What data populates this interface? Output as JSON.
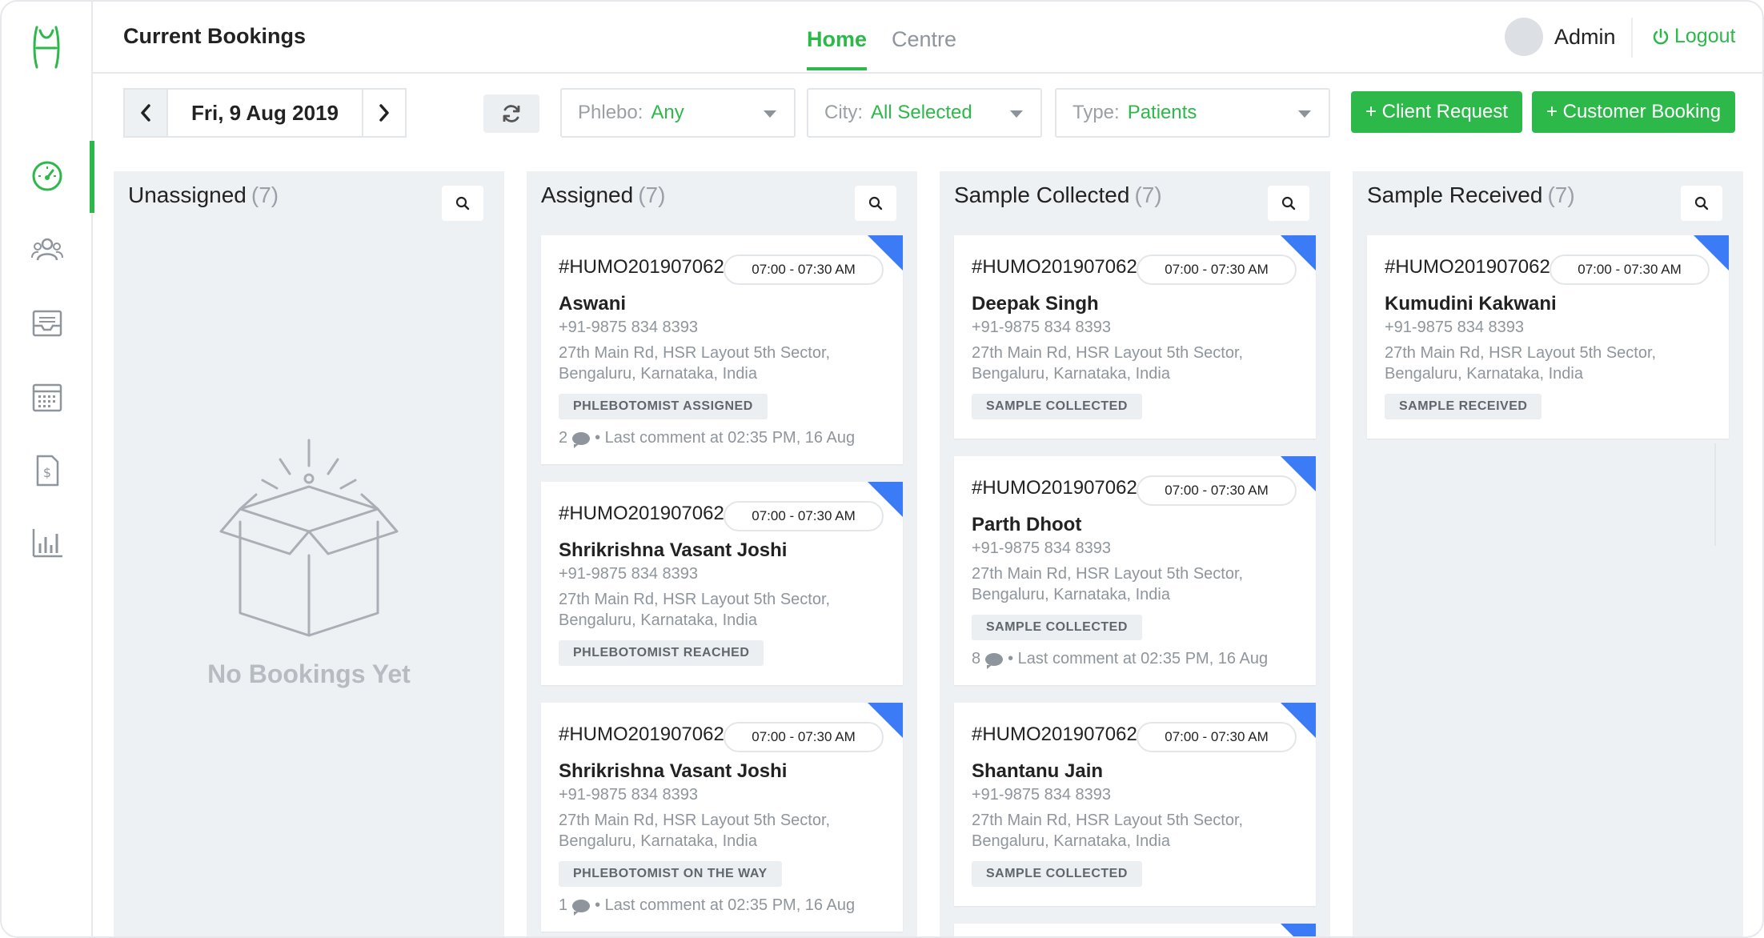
{
  "header": {
    "title": "Current Bookings",
    "tabs": [
      "Home",
      "Centre"
    ],
    "user": "Admin",
    "logout": "Logout"
  },
  "toolbar": {
    "date": "Fri, 9 Aug 2019",
    "phlebo": {
      "label": "Phlebo:",
      "value": "Any"
    },
    "city": {
      "label": "City:",
      "value": "All Selected"
    },
    "type": {
      "label": "Type:",
      "value": "Patients"
    },
    "client_request": "+ Client Request",
    "customer_booking": "+ Customer Booking"
  },
  "columns": [
    {
      "title": "Unassigned",
      "count": "(7)",
      "empty_text": "No Bookings Yet"
    },
    {
      "title": "Assigned",
      "count": "(7)"
    },
    {
      "title": "Sample Collected",
      "count": "(7)"
    },
    {
      "title": "Sample Received",
      "count": "(7)"
    }
  ],
  "cards": {
    "assigned": [
      {
        "id": "#HUMO2019070624",
        "slot": "07:00 - 07:30 AM",
        "name": "Aswani",
        "phone": "+91-9875 834 8393",
        "address_1": "27th Main Rd, HSR Layout 5th Sector,",
        "address_2": "Bengaluru, Karnataka, India",
        "status": "PHLEBOTOMIST ASSIGNED",
        "comment_count": "2",
        "comment_text": "• Last comment at 02:35 PM, 16 Aug"
      },
      {
        "id": "#HUMO2019070624",
        "slot": "07:00 - 07:30 AM",
        "name": "Shrikrishna Vasant Joshi",
        "phone": "+91-9875 834 8393",
        "address_1": "27th Main Rd, HSR Layout 5th Sector,",
        "address_2": "Bengaluru, Karnataka, India",
        "status": "PHLEBOTOMIST REACHED"
      },
      {
        "id": "#HUMO2019070624",
        "slot": "07:00 - 07:30 AM",
        "name": "Shrikrishna Vasant Joshi",
        "phone": "+91-9875 834 8393",
        "address_1": "27th Main Rd, HSR Layout 5th Sector,",
        "address_2": "Bengaluru, Karnataka, India",
        "status": "PHLEBOTOMIST ON THE WAY",
        "comment_count": "1",
        "comment_text": "• Last comment at 02:35 PM, 16 Aug"
      }
    ],
    "collected": [
      {
        "id": "#HUMO2019070624",
        "slot": "07:00 - 07:30 AM",
        "name": "Deepak Singh",
        "phone": "+91-9875 834 8393",
        "address_1": "27th Main Rd, HSR Layout 5th Sector,",
        "address_2": "Bengaluru, Karnataka, India",
        "status": "SAMPLE COLLECTED"
      },
      {
        "id": "#HUMO2019070624",
        "slot": "07:00 - 07:30 AM",
        "name": "Parth Dhoot",
        "phone": "+91-9875 834 8393",
        "address_1": "27th Main Rd, HSR Layout 5th Sector,",
        "address_2": "Bengaluru, Karnataka, India",
        "status": "SAMPLE COLLECTED",
        "comment_count": "8",
        "comment_text": "• Last comment at 02:35 PM, 16 Aug"
      },
      {
        "id": "#HUMO2019070624",
        "slot": "07:00 - 07:30 AM",
        "name": "Shantanu Jain",
        "phone": "+91-9875 834 8393",
        "address_1": "27th Main Rd, HSR Layout 5th Sector,",
        "address_2": "Bengaluru, Karnataka, India",
        "status": "SAMPLE COLLECTED"
      }
    ],
    "received": [
      {
        "id": "#HUMO2019070624",
        "slot": "07:00 - 07:30 AM",
        "name": "Kumudini Kakwani",
        "phone": "+91-9875 834 8393",
        "address_1": "27th Main Rd, HSR Layout 5th Sector,",
        "address_2": "Bengaluru, Karnataka, India",
        "status": "SAMPLE RECEIVED"
      }
    ]
  },
  "colors": {
    "accent": "#2db84a",
    "corner": "#3b7bf6",
    "column_bg": "#eef1f4"
  },
  "icons": [
    "logo-icon",
    "dashboard-icon",
    "users-icon",
    "inbox-icon",
    "calendar-icon",
    "invoice-icon",
    "reports-icon",
    "search-icon",
    "refresh-icon",
    "power-icon",
    "comment-icon",
    "open-box-icon"
  ]
}
